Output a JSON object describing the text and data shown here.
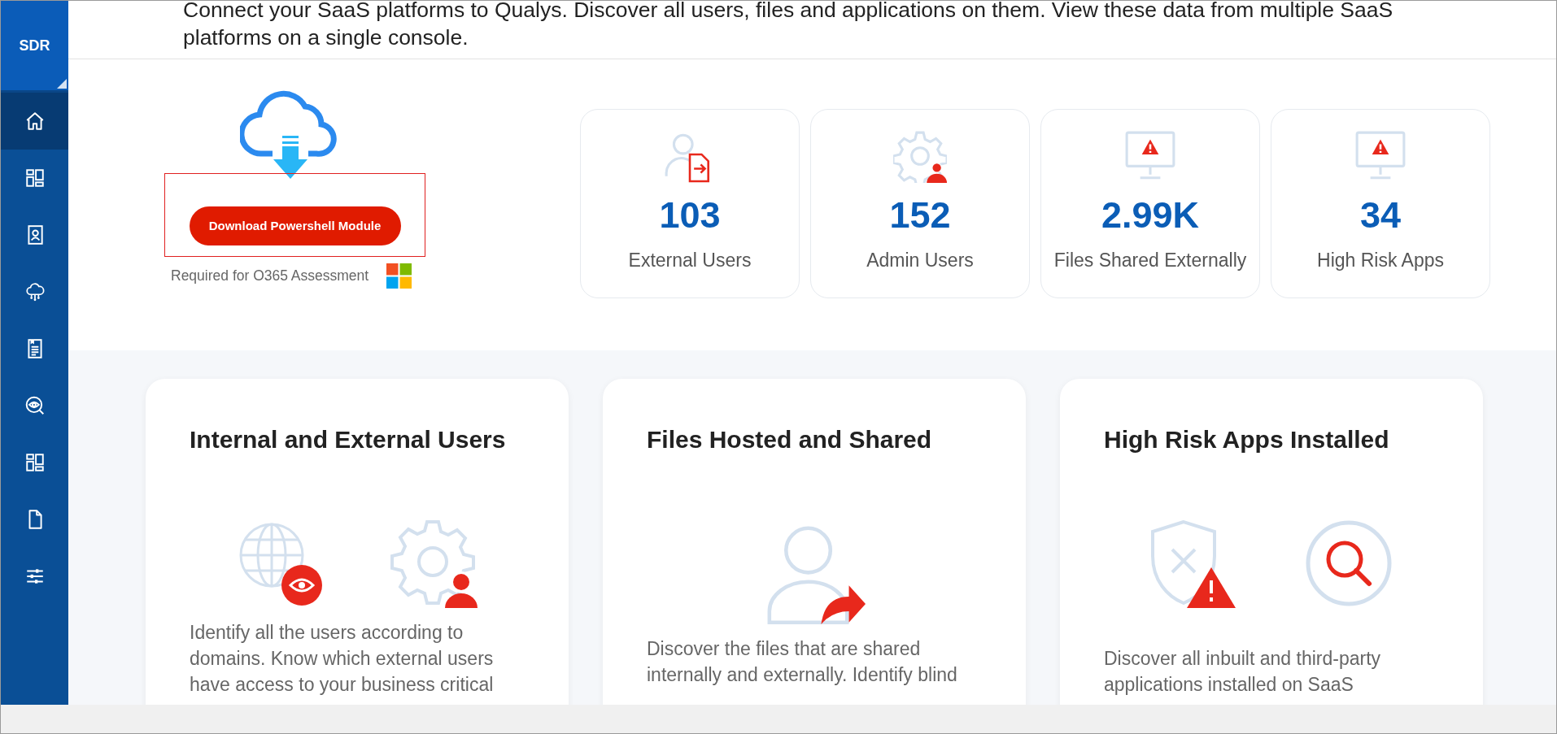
{
  "sidebar": {
    "logo": "SDR",
    "items": [
      {
        "kind": "home",
        "selected": true
      },
      {
        "kind": "dashboard",
        "selected": false
      },
      {
        "kind": "contact",
        "selected": false
      },
      {
        "kind": "cloud",
        "selected": false
      },
      {
        "kind": "document",
        "selected": false
      },
      {
        "kind": "eye-search",
        "selected": false
      },
      {
        "kind": "dashboard",
        "selected": false
      },
      {
        "kind": "file",
        "selected": false
      },
      {
        "kind": "sliders",
        "selected": false
      }
    ]
  },
  "header": {
    "description_lines": [
      "Connect your SaaS platforms to Qualys. Discover all users, files and applications on them. View these data from multiple SaaS",
      "platforms on a single console."
    ]
  },
  "download": {
    "button": "Download Powershell Module",
    "note": "Required for O365 Assessment"
  },
  "stats": [
    {
      "kind": "user-file",
      "value": "103",
      "label": "External Users"
    },
    {
      "kind": "gear-user",
      "value": "152",
      "label": "Admin Users"
    },
    {
      "kind": "monitor-alert",
      "value": "2.99K",
      "label": "Files Shared Externally"
    },
    {
      "kind": "monitor-alert",
      "value": "34",
      "label": "High Risk Apps"
    }
  ],
  "feature_cards": [
    {
      "title": "Internal and External Users",
      "icons": [
        {
          "kind": "globe-eye"
        },
        {
          "kind": "gear-user"
        }
      ],
      "description_lines": [
        "Identify all the users according to",
        "domains. Know which external users",
        "have access to your business critical"
      ]
    },
    {
      "title": "Files Hosted and Shared",
      "icons": [
        {
          "kind": "user-share"
        }
      ],
      "description_lines": [
        "Discover the files that are shared",
        "internally and externally. Identify blind"
      ]
    },
    {
      "title": "High Risk Apps Installed",
      "icons": [
        {
          "kind": "shield-alert"
        },
        {
          "kind": "search-circle"
        }
      ],
      "description_lines": [
        "Discover all inbuilt and third-party",
        "applications installed on SaaS"
      ]
    }
  ]
}
